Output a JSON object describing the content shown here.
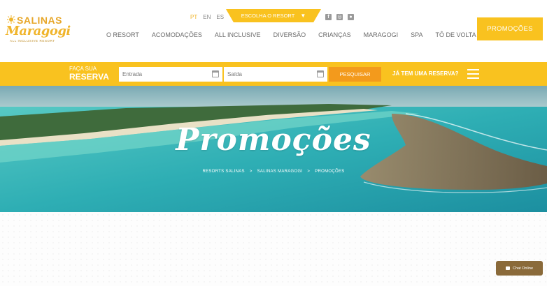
{
  "logo": {
    "brand_top": "SALINAS",
    "brand_script": "Maragogi",
    "tagline": "ALL INCLUSIVE RESORT"
  },
  "languages": [
    {
      "code": "PT",
      "active": true
    },
    {
      "code": "EN",
      "active": false
    },
    {
      "code": "ES",
      "active": false
    }
  ],
  "resort_select": {
    "label": "ESCOLHA O RESORT",
    "caret": "▼"
  },
  "social": [
    {
      "icon": "facebook-icon",
      "glyph": "f"
    },
    {
      "icon": "instagram-icon",
      "glyph": "◎"
    },
    {
      "icon": "tripadvisor-icon",
      "glyph": "●"
    }
  ],
  "nav": [
    "O RESORT",
    "ACOMODAÇÕES",
    "ALL INCLUSIVE",
    "DIVERSÃO",
    "CRIANÇAS",
    "MARAGOGI",
    "SPA",
    "TÔ DE VOLTA"
  ],
  "promo_button": "PROMOÇÕES",
  "reservation": {
    "title_line1": "FAÇA SUA",
    "title_line2": "RESERVA",
    "checkin_placeholder": "Entrada",
    "checkout_placeholder": "Saída",
    "search_label": "PESQUISAR",
    "have_reservation": "JÁ TEM UMA RESERVA?"
  },
  "hero": {
    "title": "Promoções",
    "breadcrumb": [
      "RESORTS SALINAS",
      "SALINAS MARAGOGI",
      "PROMOÇÕES"
    ],
    "separator": ">"
  },
  "chat": {
    "label": "Chat Online"
  },
  "colors": {
    "accent_yellow": "#f9c21f",
    "accent_orange": "#f39a1c",
    "sea": "#2fb3b8",
    "chat": "#8a6a3a"
  }
}
